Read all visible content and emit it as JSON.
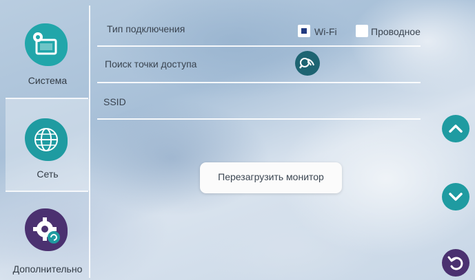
{
  "sidebar": {
    "items": [
      {
        "label": "Система",
        "icon": "monitor-settings-icon"
      },
      {
        "label": "Сеть",
        "icon": "globe-network-icon"
      },
      {
        "label": "Дополнительно",
        "icon": "gear-refresh-icon"
      }
    ],
    "active_index": 1
  },
  "settings": {
    "connection_type": {
      "label": "Тип подключения",
      "options": [
        {
          "label": "Wi-Fi",
          "checked": true
        },
        {
          "label": "Проводное",
          "checked": false
        }
      ]
    },
    "access_point_search": {
      "label": "Поиск точки доступа",
      "icon": "wifi-search-icon"
    },
    "ssid": {
      "label": "SSID",
      "value": ""
    }
  },
  "toast": {
    "text": "Перезагрузить монитор"
  },
  "controls": {
    "scroll_up_icon": "chevron-up-icon",
    "scroll_down_icon": "chevron-down-icon",
    "back_icon": "back-icon"
  },
  "colors": {
    "teal": "#1f9ba1",
    "purple_dark": "#4b3170",
    "checkbox_mark": "#213a80"
  }
}
